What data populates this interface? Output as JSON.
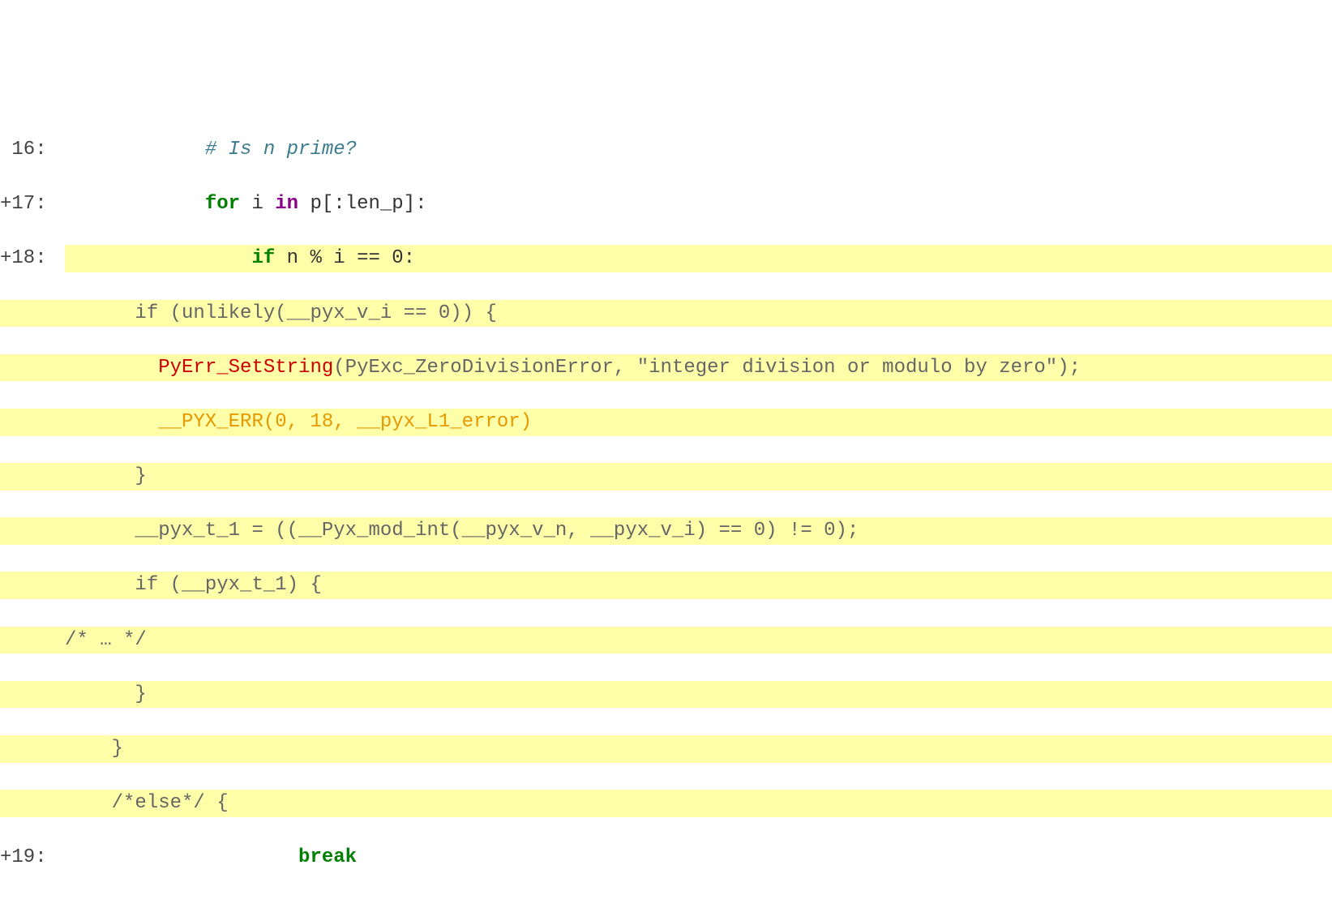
{
  "lines": {
    "l16_num": " 16:",
    "l16_content": "            # Is n prime?",
    "l17_num": "+17:",
    "l17_indent": "            ",
    "l17_for": "for",
    "l17_mid1": " i ",
    "l17_in": "in",
    "l17_mid2": " p[:len_p]:",
    "l18_num": "+18:",
    "l18_indent": "                ",
    "l18_if": "if",
    "l18_rest": " n % i == 0:",
    "c1": "      if (unlikely(__pyx_v_i == 0)) {",
    "c2_indent": "        ",
    "c2_red": "PyErr_SetString",
    "c2_rest": "(PyExc_ZeroDivisionError, \"integer division or modulo by zero\");",
    "c3_indent": "        ",
    "c3_orange": "__PYX_ERR(0, 18, __pyx_L1_error)",
    "c4": "      }",
    "c5": "      __pyx_t_1 = ((__Pyx_mod_int(__pyx_v_n, __pyx_v_i) == 0) != 0);",
    "c6": "      if (__pyx_t_1) {",
    "c7": "/* … */",
    "c8": "      }",
    "c9": "    }",
    "c10": "    /*else*/ {",
    "l19_num": "+19:",
    "l19_indent": "                    ",
    "l19_break": "break"
  }
}
